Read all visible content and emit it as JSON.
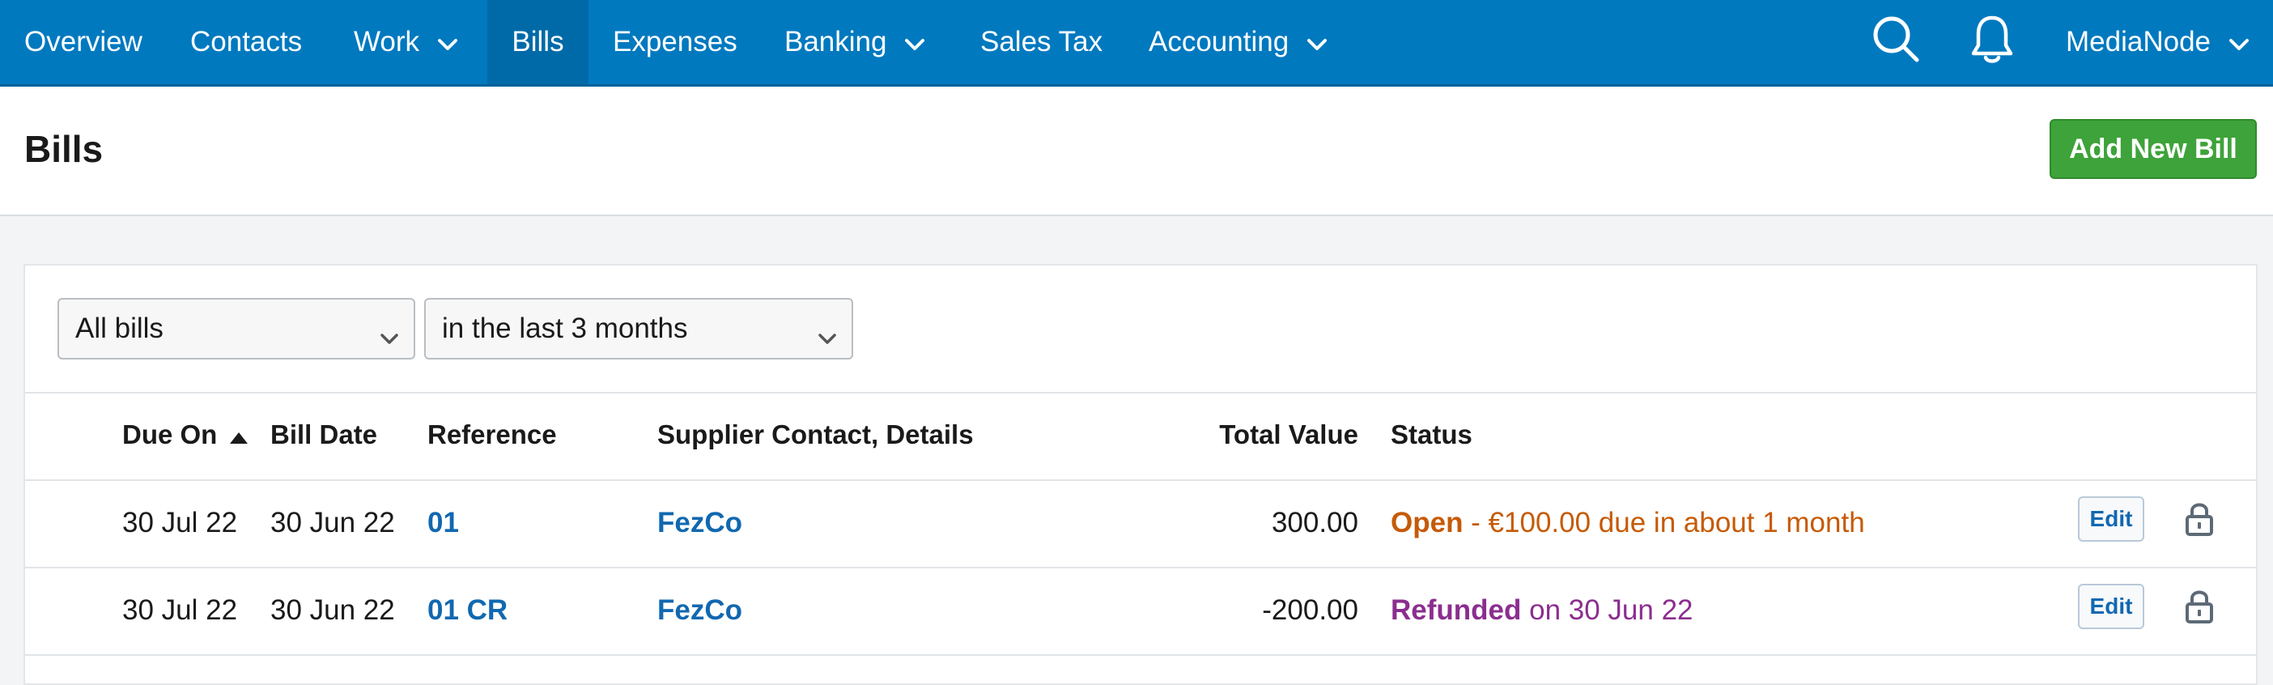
{
  "nav": {
    "items": [
      {
        "label": "Overview"
      },
      {
        "label": "Contacts"
      },
      {
        "label": "Work"
      },
      {
        "label": "Bills"
      },
      {
        "label": "Expenses"
      },
      {
        "label": "Banking"
      },
      {
        "label": "Sales Tax"
      },
      {
        "label": "Accounting"
      }
    ],
    "active": "Bills",
    "account": "MediaNode"
  },
  "header": {
    "title": "Bills",
    "add_button": "Add New Bill"
  },
  "filters": {
    "type": "All bills",
    "period": "in the last 3 months"
  },
  "table": {
    "columns": {
      "due_on": "Due On",
      "bill_date": "Bill Date",
      "reference": "Reference",
      "supplier": "Supplier Contact, Details",
      "total": "Total Value",
      "status": "Status"
    },
    "rows": [
      {
        "due_on": "30 Jul 22",
        "bill_date": "30 Jun 22",
        "reference": "01",
        "supplier": "FezCo",
        "total": "300.00",
        "status_word": "Open",
        "status_detail": " - €100.00 due in about 1 month",
        "edit": "Edit"
      },
      {
        "due_on": "30 Jul 22",
        "bill_date": "30 Jun 22",
        "reference": "01 CR",
        "supplier": "FezCo",
        "total": "-200.00",
        "status_word": "Refunded",
        "status_detail": " on 30 Jun 22",
        "edit": "Edit"
      }
    ]
  },
  "colors": {
    "nav_bg": "#0079bf",
    "add_button": "#3ea33a",
    "link": "#1168b0",
    "status_open": "#c65a06",
    "status_refunded": "#8b2e8f"
  },
  "icons": [
    "chevron-down-icon",
    "search-icon",
    "bell-icon",
    "lock-icon",
    "sort-up-icon"
  ]
}
